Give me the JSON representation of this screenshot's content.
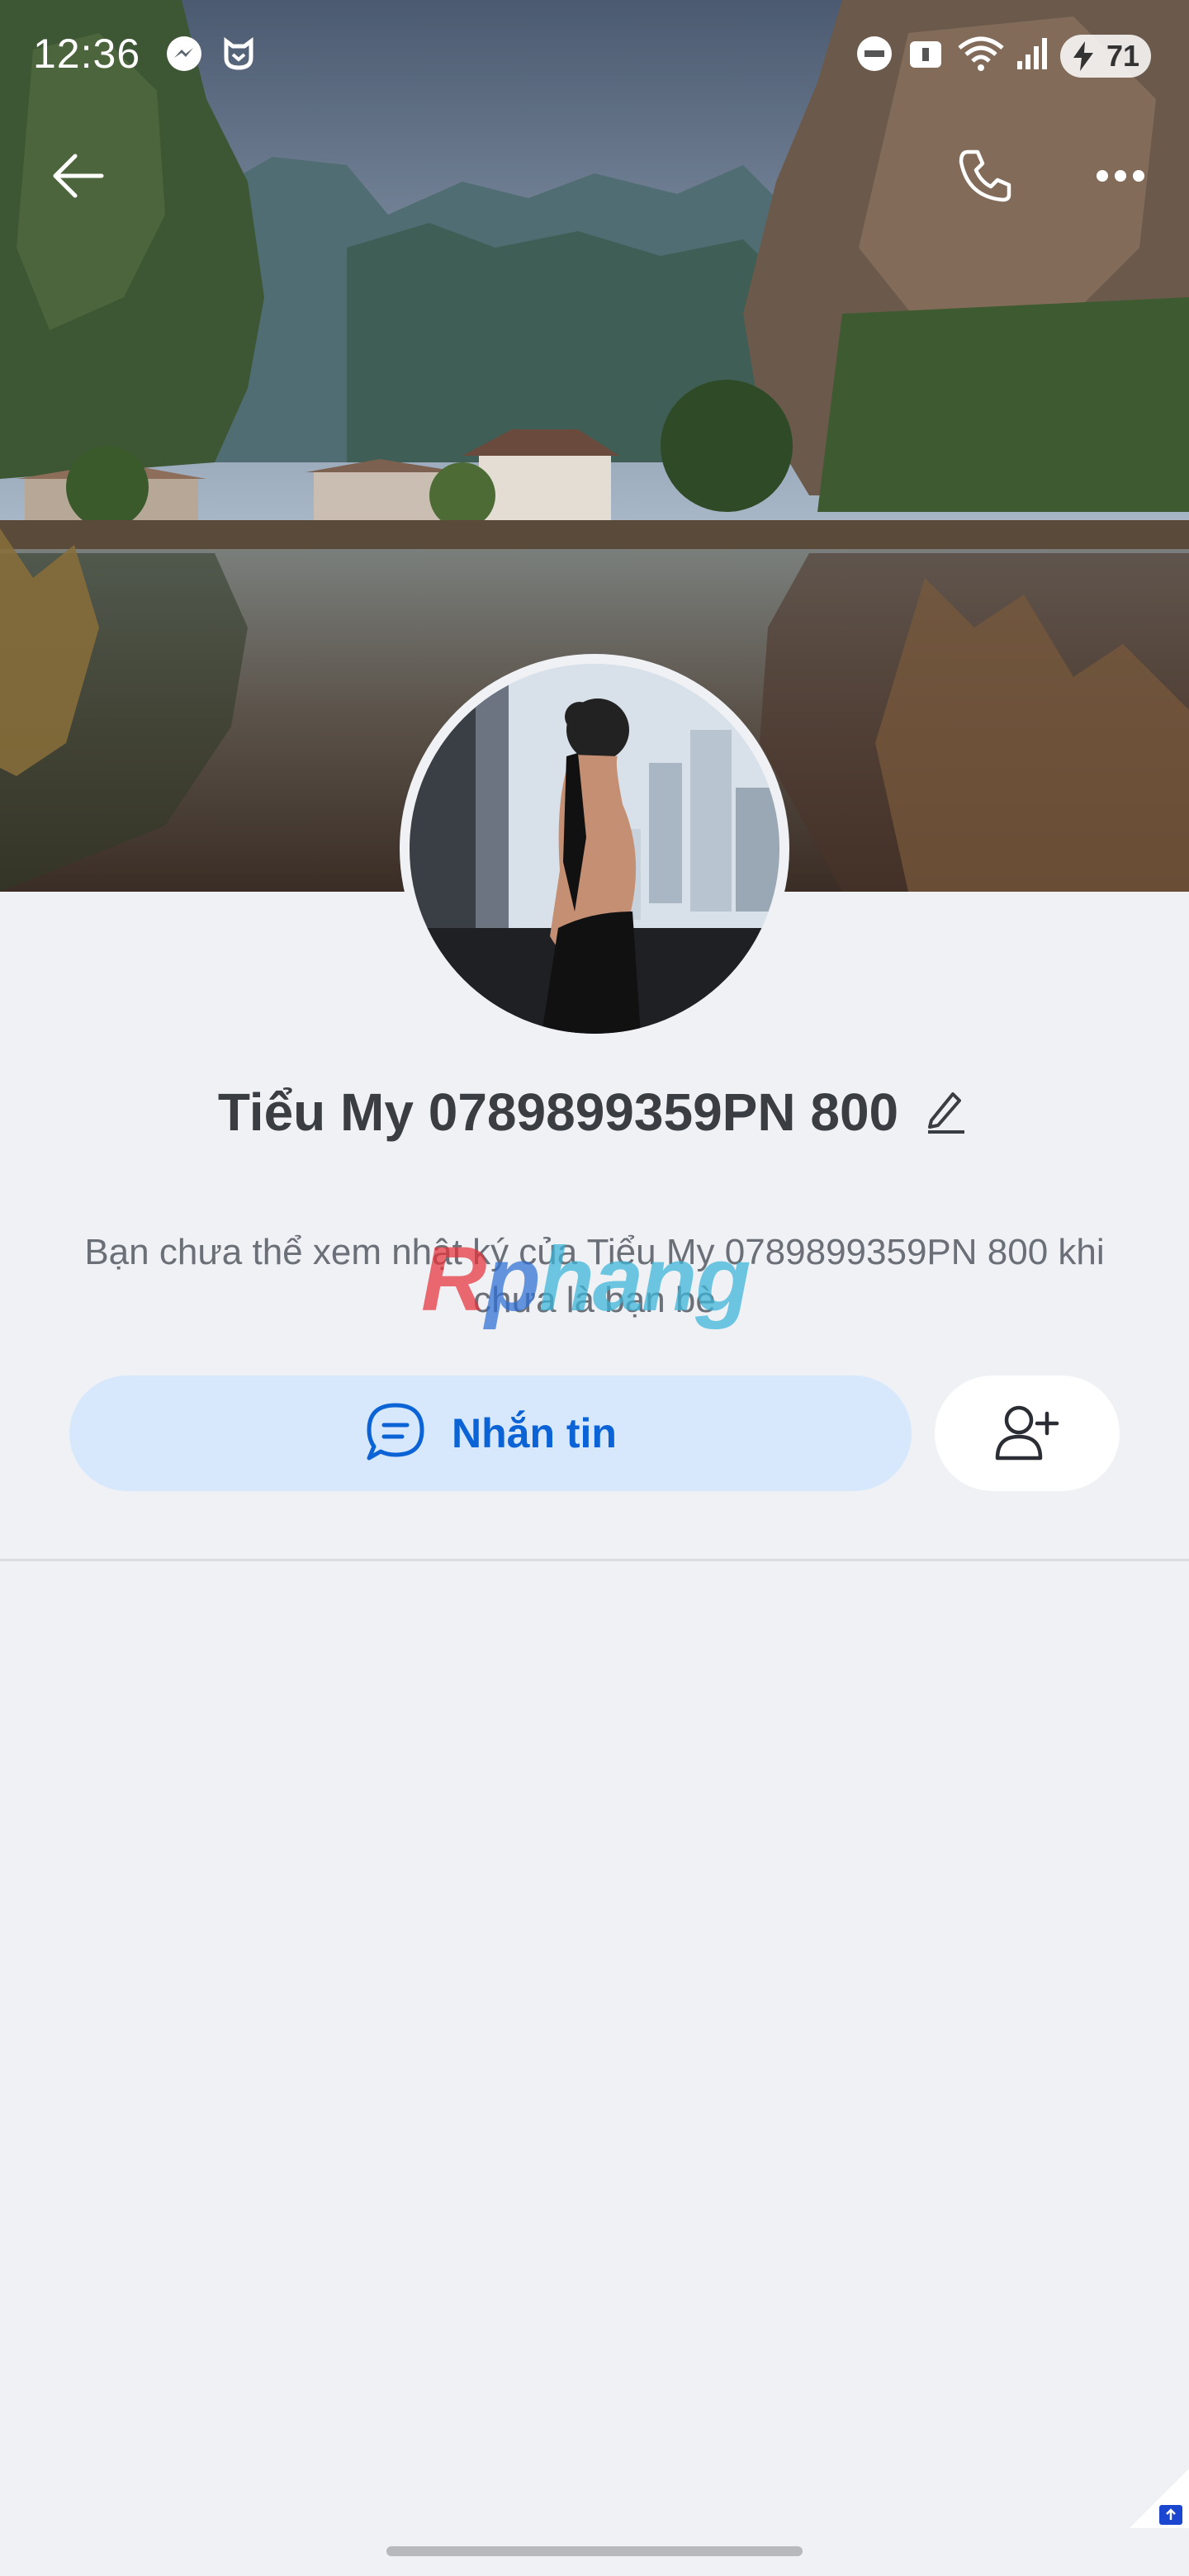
{
  "status_bar": {
    "time": "12:36",
    "battery": "71",
    "icons": [
      "messenger-icon",
      "mi-icon",
      "do-not-disturb-icon",
      "lock-icon",
      "wifi-icon",
      "signal-icon",
      "battery-icon"
    ]
  },
  "nav": {
    "back_icon": "back-arrow-icon",
    "call_icon": "phone-icon",
    "more_icon": "more-horizontal-icon"
  },
  "profile": {
    "name": "Tiểu My 0789899359PN 800",
    "edit_icon": "pencil-icon",
    "notice": "Bạn chưa thể xem nhật ký của Tiểu My 0789899359PN 800 khi chưa là bạn bè"
  },
  "watermark": {
    "r": "R",
    "p": "p",
    "rest": "hang"
  },
  "actions": {
    "message_label": "Nhắn tin",
    "message_icon": "chat-bubble-icon",
    "add_friend_icon": "add-friend-icon"
  },
  "colors": {
    "accent": "#0b63d6",
    "message_button_bg": "#d7e8fd",
    "page_bg": "#eff1f5",
    "name_text": "#3a3d42"
  }
}
